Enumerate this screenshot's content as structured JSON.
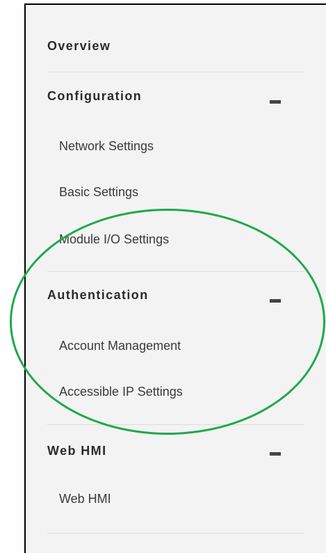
{
  "nav": {
    "overview": "Overview",
    "configuration": {
      "title": "Configuration",
      "items": [
        "Network Settings",
        "Basic Settings",
        "Module I/O Settings"
      ]
    },
    "authentication": {
      "title": "Authentication",
      "items": [
        "Account Management",
        "Accessible IP Settings"
      ]
    },
    "web_hmi": {
      "title": "Web HMI",
      "items": [
        "Web HMI"
      ]
    }
  },
  "colors": {
    "panel_background": "#f3f3f3",
    "annotation_oval": "#1fa84b"
  },
  "icons": [
    "minus-icon"
  ]
}
